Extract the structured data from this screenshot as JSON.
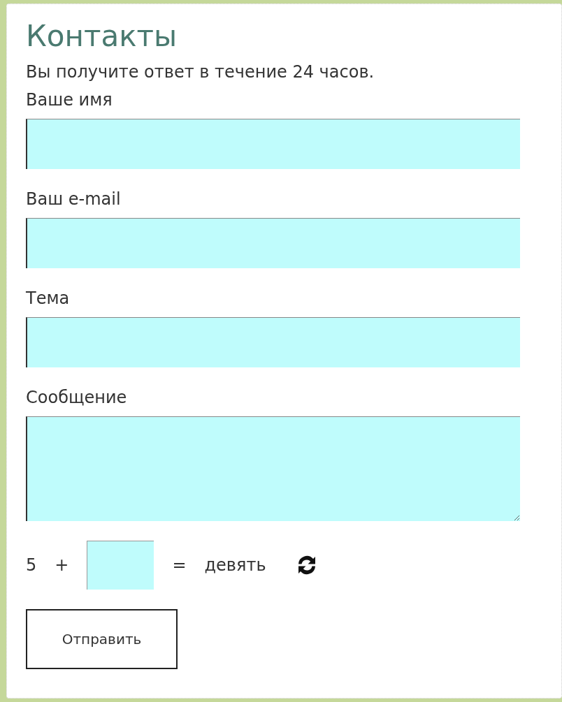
{
  "title": "Контакты",
  "subtitle": "Вы получите ответ в течение 24 часов.",
  "fields": [
    {
      "label": "Ваше имя",
      "kind": "text"
    },
    {
      "label": "Ваш e-mail",
      "kind": "text"
    },
    {
      "label": "Тема",
      "kind": "text"
    },
    {
      "label": "Сообщение",
      "kind": "textarea"
    }
  ],
  "captcha": {
    "operand": "5",
    "operator": "+",
    "equals": "=",
    "result": "девять"
  },
  "submit": "Отправить"
}
